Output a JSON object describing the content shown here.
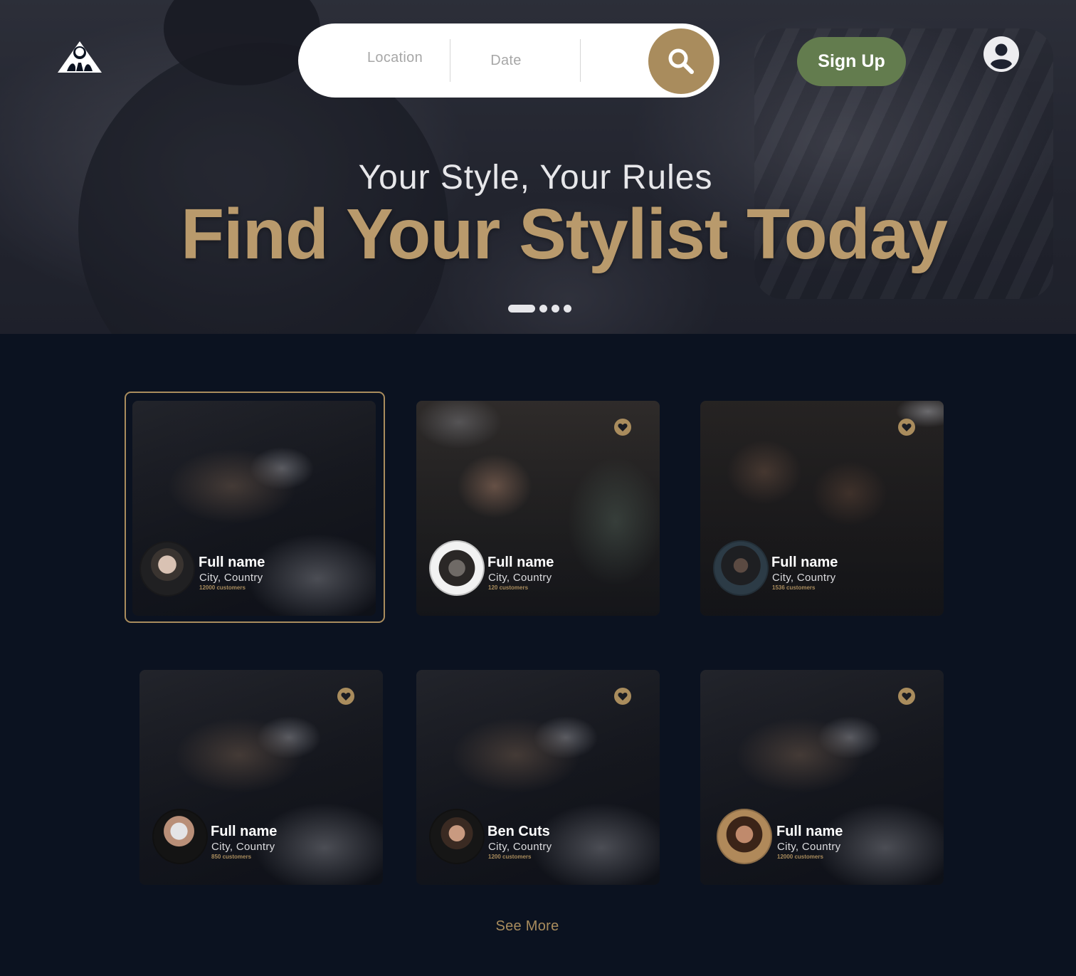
{
  "header": {
    "logo_icon": "hair-salon-logo-icon",
    "search": {
      "location_placeholder": "Location",
      "date_placeholder": "Date",
      "button_icon": "search-icon"
    },
    "signup_label": "Sign Up",
    "account_icon": "user-account-icon"
  },
  "hero": {
    "subtitle": "Your Style, Your Rules",
    "title": "Find Your Stylist Today",
    "carousel": {
      "total": 4,
      "active": 1
    }
  },
  "stylists": [
    {
      "name": "Full name",
      "location": "City, Country",
      "customers": "12000 customers",
      "favorite_icon": "heart-icon",
      "selected": true
    },
    {
      "name": "Full name",
      "location": "City, Country",
      "customers": "120 customers",
      "favorite_icon": "heart-icon",
      "selected": false
    },
    {
      "name": "Full name",
      "location": "City, Country",
      "customers": "1536 customers",
      "favorite_icon": "heart-icon",
      "selected": false
    },
    {
      "name": "Full name",
      "location": "City, Country",
      "customers": "850 customers",
      "favorite_icon": "heart-icon",
      "selected": false
    },
    {
      "name": "Ben Cuts",
      "location": "City, Country",
      "customers": "1200 customers",
      "favorite_icon": "heart-icon",
      "selected": false
    },
    {
      "name": "Full name",
      "location": "City, Country",
      "customers": "12000 customers",
      "favorite_icon": "heart-icon",
      "selected": false
    }
  ],
  "see_more_label": "See More",
  "colors": {
    "accent_gold": "#a98c5d",
    "title_gold": "#b99a6c",
    "signup_green": "#637c4e",
    "background": "#0b1220"
  }
}
